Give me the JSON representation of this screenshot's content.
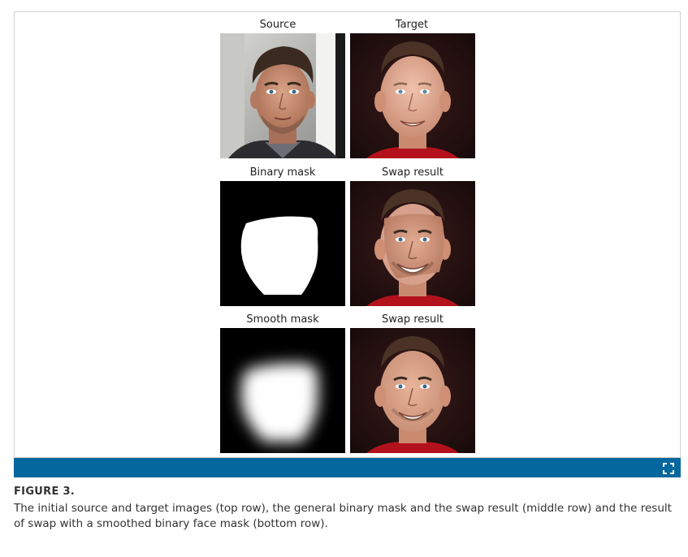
{
  "figure": {
    "panels": {
      "source": {
        "label": "Source",
        "icon": "face-photo-source"
      },
      "target": {
        "label": "Target",
        "icon": "face-photo-target"
      },
      "binary_mask": {
        "label": "Binary mask",
        "icon": "binary-mask-image"
      },
      "swap_result_1": {
        "label": "Swap result",
        "icon": "face-photo-swap"
      },
      "smooth_mask": {
        "label": "Smooth mask",
        "icon": "smooth-mask-image"
      },
      "swap_result_2": {
        "label": "Swap result",
        "icon": "face-photo-swap"
      }
    },
    "toolbar": {
      "color": "#04679d",
      "expand_icon": "expand-icon"
    },
    "caption": {
      "title": "FIGURE 3.",
      "text": "The initial source and target images (top row), the general binary mask and the swap result (middle row) and the result of swap with a smoothed binary face mask (bottom row)."
    }
  }
}
